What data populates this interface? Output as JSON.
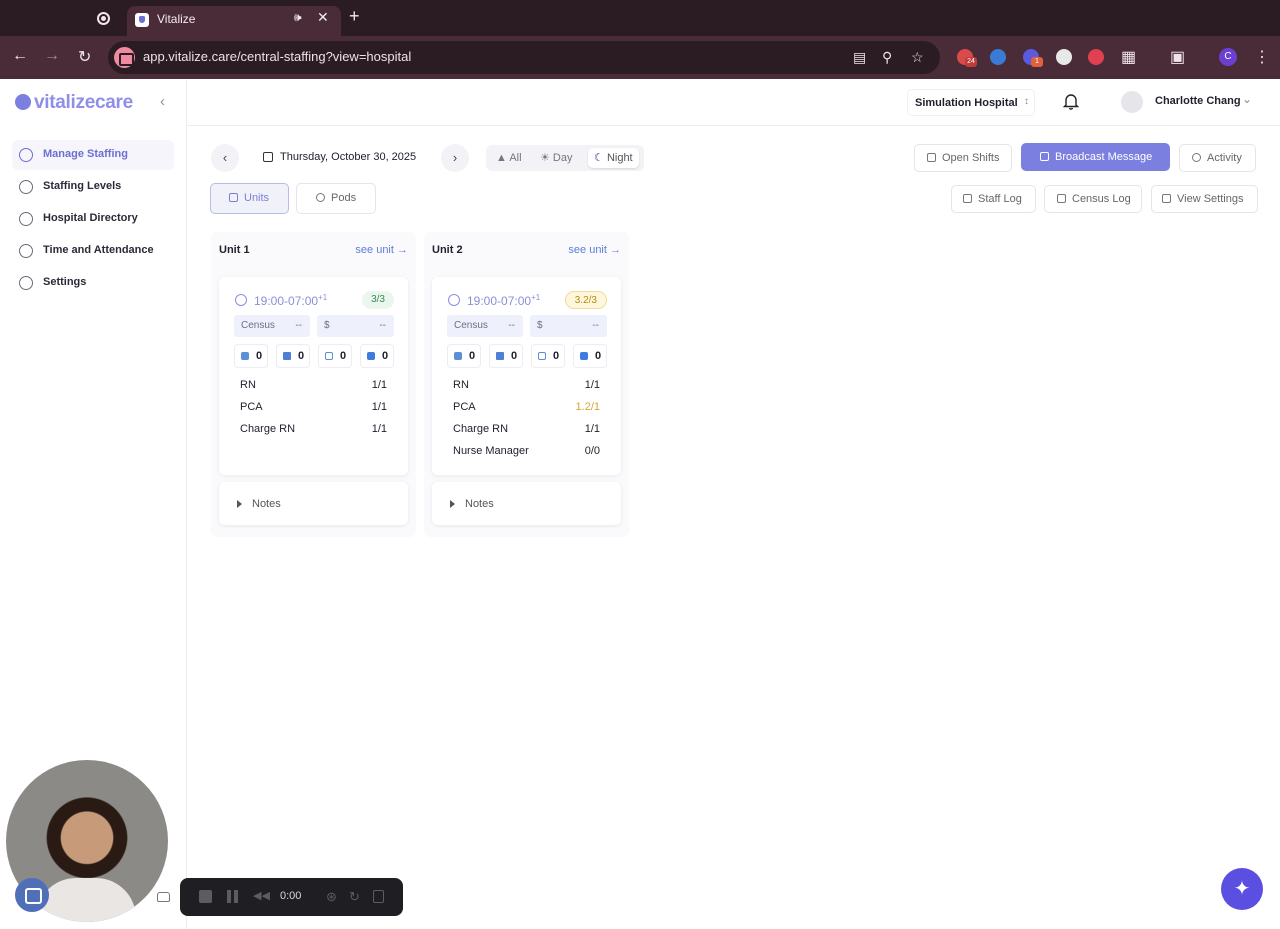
{
  "browser": {
    "tab_title": "Vitalize",
    "url": "app.vitalize.care/central-staffing?view=hospital",
    "ext_badges": [
      "24",
      "1"
    ],
    "profile_initial": "C"
  },
  "sidebar": {
    "logo_text": "vitalizecare",
    "items": [
      {
        "label": "Manage Staffing",
        "icon": "scale-icon"
      },
      {
        "label": "Staffing Levels",
        "icon": "users-icon"
      },
      {
        "label": "Hospital Directory",
        "icon": "user-circle-icon"
      },
      {
        "label": "Time and Attendance",
        "icon": "clock-icon"
      },
      {
        "label": "Settings",
        "icon": "gear-icon"
      }
    ]
  },
  "header": {
    "hospital": "Simulation Hospital",
    "user_name": "Charlotte Chang"
  },
  "controls": {
    "date": "Thursday, October 30, 2025",
    "shift_filter": [
      "All",
      "Day",
      "Night"
    ],
    "selected_filter": "Night",
    "view_toggle": [
      "Units",
      "Pods"
    ],
    "buttons": {
      "open_shifts": "Open Shifts",
      "broadcast": "Broadcast Message",
      "activity": "Activity",
      "staff_log": "Staff Log",
      "census_log": "Census Log",
      "view_settings": "View Settings"
    }
  },
  "units": [
    {
      "name": "Unit 1",
      "see_unit": "see unit →",
      "time": "19:00-07:00",
      "time_sup": "+1",
      "ratio": "3/3",
      "census_label": "Census",
      "census_value": "--",
      "cost_label": "$",
      "cost_value": "--",
      "stats": [
        "0",
        "0",
        "0",
        "0"
      ],
      "roles": [
        {
          "role": "RN",
          "value": "1/1"
        },
        {
          "role": "PCA",
          "value": "1/1"
        },
        {
          "role": "Charge RN",
          "value": "1/1"
        }
      ],
      "notes": "Notes"
    },
    {
      "name": "Unit 2",
      "see_unit": "see unit →",
      "time": "19:00-07:00",
      "time_sup": "+1",
      "ratio": "3.2/3",
      "census_label": "Census",
      "census_value": "--",
      "cost_label": "$",
      "cost_value": "--",
      "stats": [
        "0",
        "0",
        "0",
        "0"
      ],
      "roles": [
        {
          "role": "RN",
          "value": "1/1"
        },
        {
          "role": "PCA",
          "value": "1.2/1"
        },
        {
          "role": "Charge RN",
          "value": "1/1"
        },
        {
          "role": "Nurse Manager",
          "value": "0/0"
        }
      ],
      "notes": "Notes"
    }
  ],
  "recorder": {
    "time": "0:00"
  },
  "colors": {
    "accent": "#7b7fe0",
    "warn": "#d7a532",
    "ok": "#3a8a52"
  }
}
